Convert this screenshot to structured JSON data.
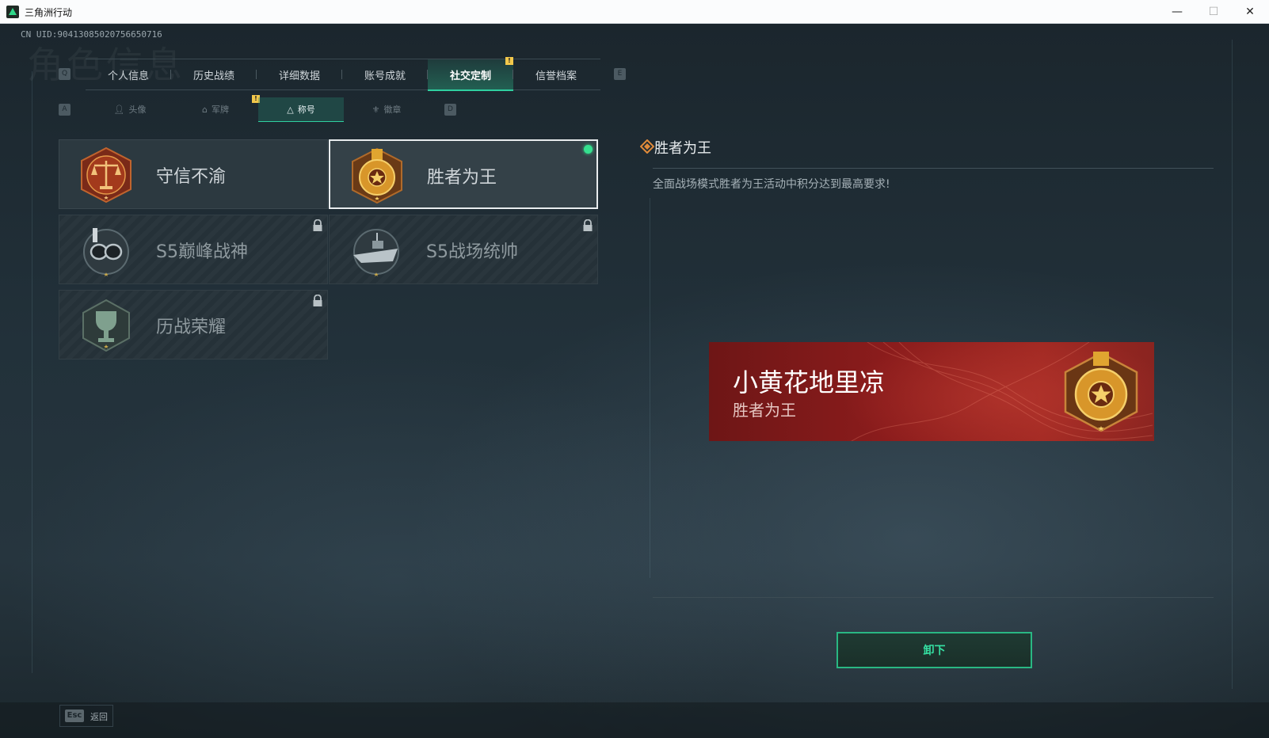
{
  "window": {
    "title": "三角洲行动",
    "minimize": "—",
    "maximize": "☐",
    "close": "✕"
  },
  "header": {
    "uid": "CN UID:9041308502075665071​6",
    "bg_title": "角色信息"
  },
  "main_tabs": {
    "prev_key": "Q",
    "next_key": "E",
    "items": [
      {
        "label": "个人信息"
      },
      {
        "label": "历史战绩"
      },
      {
        "label": "详细数据"
      },
      {
        "label": "账号成就"
      },
      {
        "label": "社交定制",
        "active": true,
        "notification": "!"
      },
      {
        "label": "信誉档案"
      }
    ]
  },
  "sub_tabs": {
    "prev_key": "A",
    "next_key": "D",
    "items": [
      {
        "label": "头像",
        "icon": "person-icon"
      },
      {
        "label": "军牌",
        "icon": "dogtag-icon",
        "notification": "!"
      },
      {
        "label": "称号",
        "icon": "title-triangle-icon",
        "active": true
      },
      {
        "label": "徽章",
        "icon": "badge-icon"
      }
    ]
  },
  "titles": [
    {
      "name": "守信不渝",
      "locked": false,
      "selected": false,
      "emblem": "scales-emblem-icon"
    },
    {
      "name": "胜者为王",
      "locked": false,
      "selected": true,
      "equipped": true,
      "emblem": "medal-star-emblem-icon"
    },
    {
      "name": "S5巅峰战神",
      "locked": true,
      "emblem": "diver-mask-emblem-icon"
    },
    {
      "name": "S5战场统帅",
      "locked": true,
      "emblem": "boat-emblem-icon"
    },
    {
      "name": "历战荣耀",
      "locked": true,
      "emblem": "trophy-emblem-icon"
    }
  ],
  "detail": {
    "title": "胜者为王",
    "description": "全面战场模式胜者为王活动中积分达到最高要求!"
  },
  "nameplate": {
    "player_name": "小黄花地里凉",
    "title": "胜者为王"
  },
  "actions": {
    "unequip_label": "卸下"
  },
  "bottom": {
    "esc_key": "Esc",
    "back_label": "返回"
  },
  "colors": {
    "accent": "#2fd0a0",
    "equipped_dot": "#35e08f",
    "notification": "#f2c84b",
    "nameplate_red": "#8b1c1c",
    "medal_gold": "#e0a530",
    "medal_bronze": "#8a3b1c"
  }
}
